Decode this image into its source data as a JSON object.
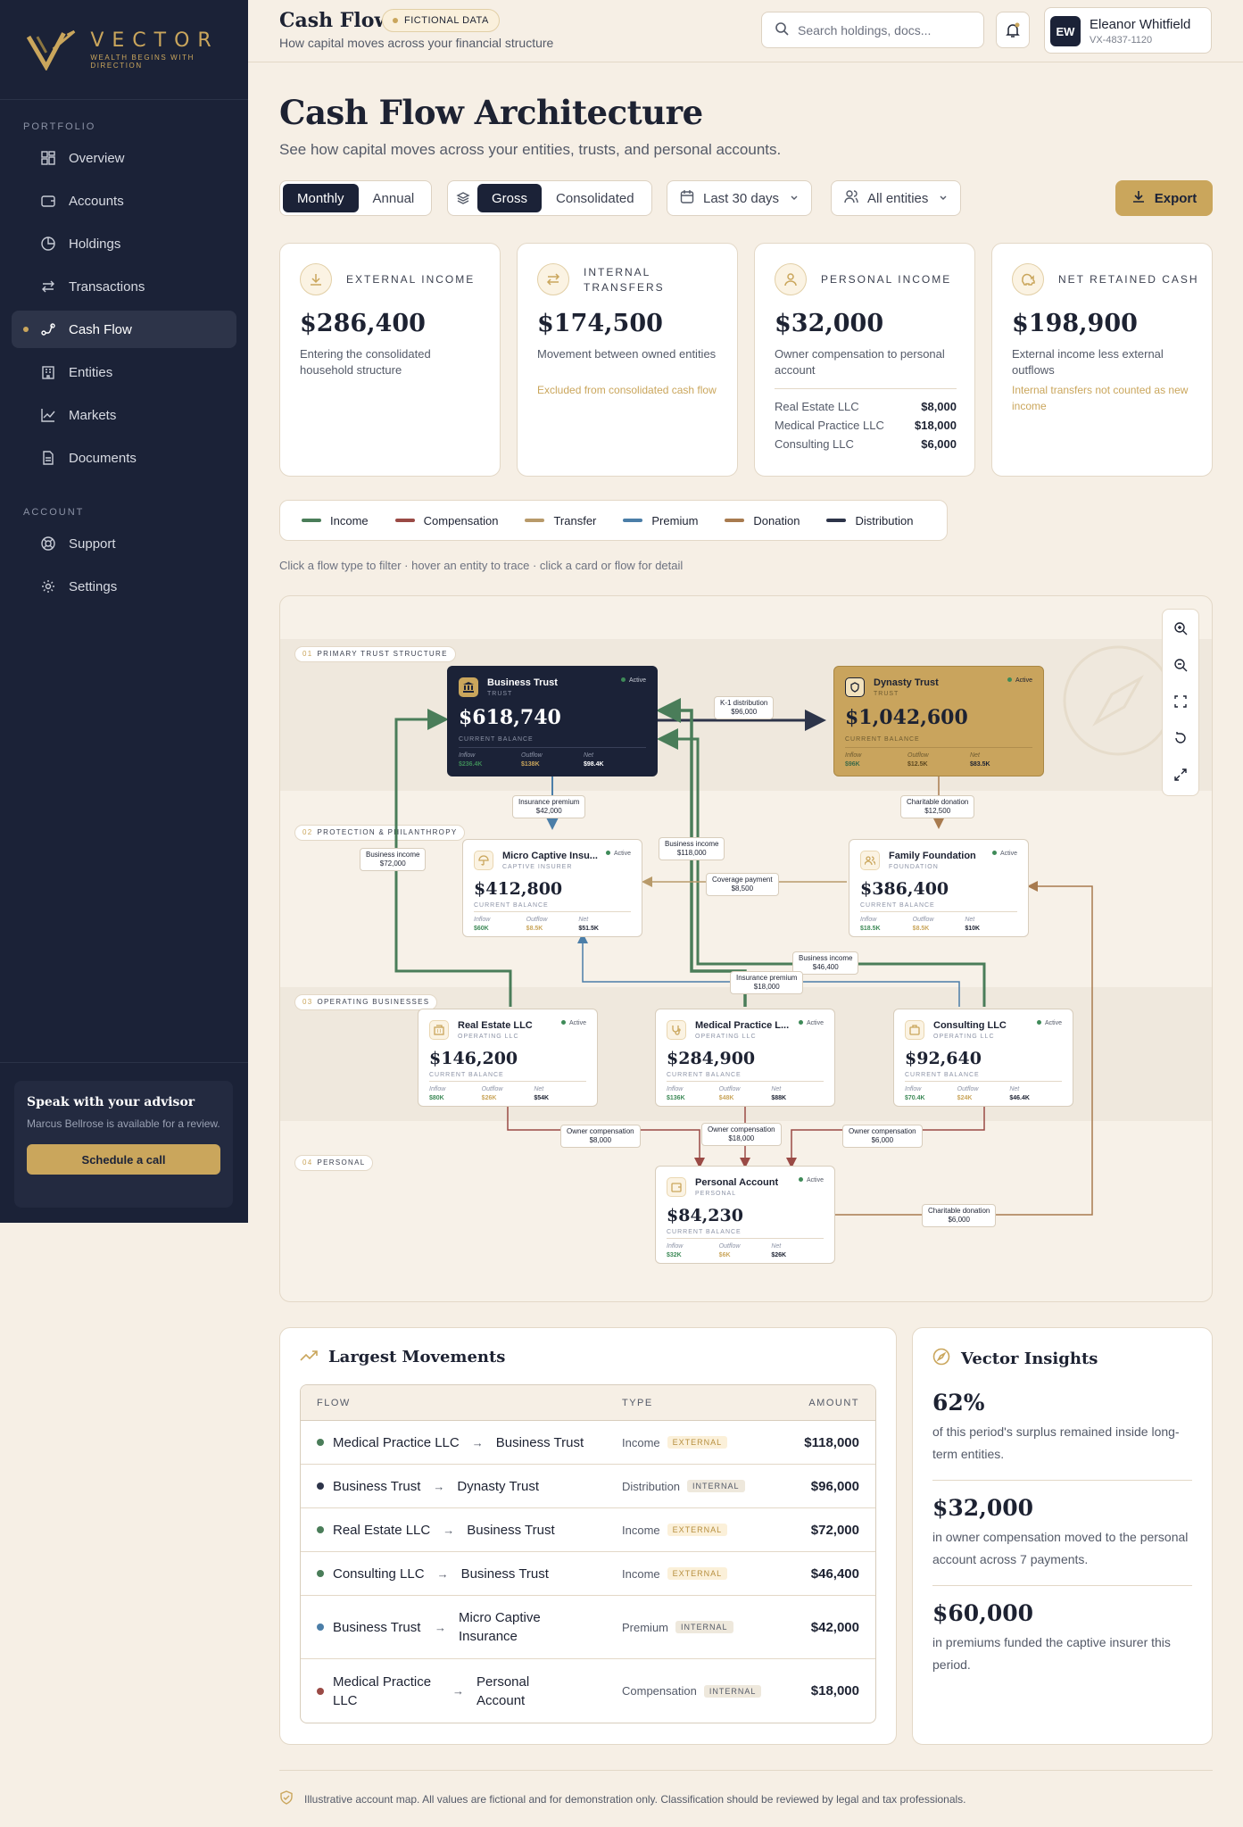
{
  "brand": {
    "name": "VECTOR",
    "tagline": "WEALTH BEGINS WITH DIRECTION",
    "accent": "#caa65c",
    "navy": "#1b2237"
  },
  "sidebar": {
    "portfolio_head": "PORTFOLIO",
    "items": [
      {
        "label": "Overview",
        "icon": "grid-icon"
      },
      {
        "label": "Accounts",
        "icon": "wallet-icon"
      },
      {
        "label": "Holdings",
        "icon": "pie-icon"
      },
      {
        "label": "Transactions",
        "icon": "swap-icon"
      },
      {
        "label": "Cash Flow",
        "icon": "flow-icon",
        "active": true
      },
      {
        "label": "Entities",
        "icon": "building-icon"
      },
      {
        "label": "Markets",
        "icon": "chart-icon"
      },
      {
        "label": "Documents",
        "icon": "document-icon"
      }
    ],
    "account_head": "ACCOUNT",
    "account_items": [
      {
        "label": "Support",
        "icon": "lifebuoy-icon"
      },
      {
        "label": "Settings",
        "icon": "gear-icon"
      }
    ],
    "advisor": {
      "title": "Speak with your advisor",
      "text": "Marcus Bellrose is available for a review.",
      "button": "Schedule a call"
    }
  },
  "topbar": {
    "title": "Cash Flow",
    "badge": "FICTIONAL DATA",
    "subtitle": "How capital moves across your financial structure",
    "search_placeholder": "Search holdings, docs...",
    "user": {
      "initials": "EW",
      "name": "Eleanor Whitfield",
      "id": "VX-4837-1120"
    }
  },
  "page": {
    "title": "Cash Flow Architecture",
    "subtitle": "See how capital moves across your entities, trusts, and personal accounts."
  },
  "controls": {
    "period": [
      "Monthly",
      "Annual"
    ],
    "period_selected": "Monthly",
    "view": [
      "Gross",
      "Consolidated"
    ],
    "view_selected": "Gross",
    "range": "Last 30 days",
    "entities": "All entities",
    "export": "Export"
  },
  "cards": [
    {
      "label": "EXTERNAL INCOME",
      "value": "$286,400",
      "desc": "Entering the consolidated household structure",
      "note": ""
    },
    {
      "label": "INTERNAL TRANSFERS",
      "value": "$174,500",
      "desc": "Movement between owned entities",
      "note": "Excluded from consolidated cash flow"
    },
    {
      "label": "PERSONAL INCOME",
      "value": "$32,000",
      "desc": "Owner compensation to personal account",
      "breakdown": [
        {
          "name": "Real Estate LLC",
          "amount": "$8,000"
        },
        {
          "name": "Medical Practice LLC",
          "amount": "$18,000"
        },
        {
          "name": "Consulting LLC",
          "amount": "$6,000"
        }
      ]
    },
    {
      "label": "NET RETAINED CASH",
      "value": "$198,900",
      "desc": "External income less external outflows",
      "note": "Internal transfers not counted as new income"
    }
  ],
  "legend": [
    {
      "label": "Income",
      "color": "#4a7d59"
    },
    {
      "label": "Compensation",
      "color": "#9a4a45"
    },
    {
      "label": "Transfer",
      "color": "#b89a6a"
    },
    {
      "label": "Premium",
      "color": "#4b7ea8"
    },
    {
      "label": "Donation",
      "color": "#a87b4f"
    },
    {
      "label": "Distribution",
      "color": "#2d3449"
    }
  ],
  "hint": "Click a flow type to filter · hover an entity to trace · click a card or flow for detail",
  "map": {
    "bands": [
      {
        "num": "01",
        "label": "PRIMARY TRUST STRUCTURE"
      },
      {
        "num": "02",
        "label": "PROTECTION & PHILANTHROPY"
      },
      {
        "num": "03",
        "label": "OPERATING BUSINESSES"
      },
      {
        "num": "04",
        "label": "PERSONAL"
      }
    ],
    "nodes": [
      {
        "name": "Business Trust",
        "type": "TRUST",
        "status": "Active",
        "value": "$618,740",
        "label": "CURRENT BALANCE",
        "inflow": "$236.4K",
        "outflow": "$138K",
        "net": "$98.4K"
      },
      {
        "name": "Dynasty Trust",
        "type": "TRUST",
        "status": "Active",
        "value": "$1,042,600",
        "label": "CURRENT BALANCE",
        "inflow": "$96K",
        "outflow": "$12.5K",
        "net": "$83.5K"
      },
      {
        "name": "Micro Captive Insu...",
        "type": "CAPTIVE INSURER",
        "status": "Active",
        "value": "$412,800",
        "label": "CURRENT BALANCE",
        "inflow": "$60K",
        "outflow": "$8.5K",
        "net": "$51.5K"
      },
      {
        "name": "Family Foundation",
        "type": "FOUNDATION",
        "status": "Active",
        "value": "$386,400",
        "label": "CURRENT BALANCE",
        "inflow": "$18.5K",
        "outflow": "$8.5K",
        "net": "$10K"
      },
      {
        "name": "Real Estate LLC",
        "type": "OPERATING LLC",
        "status": "Active",
        "value": "$146,200",
        "label": "CURRENT BALANCE",
        "inflow": "$80K",
        "outflow": "$26K",
        "net": "$54K"
      },
      {
        "name": "Medical Practice L...",
        "type": "OPERATING LLC",
        "status": "Active",
        "value": "$284,900",
        "label": "CURRENT BALANCE",
        "inflow": "$136K",
        "outflow": "$48K",
        "net": "$88K"
      },
      {
        "name": "Consulting LLC",
        "type": "OPERATING LLC",
        "status": "Active",
        "value": "$92,640",
        "label": "CURRENT BALANCE",
        "inflow": "$70.4K",
        "outflow": "$24K",
        "net": "$46.4K"
      },
      {
        "name": "Personal Account",
        "type": "PERSONAL",
        "status": "Active",
        "value": "$84,230",
        "label": "CURRENT BALANCE",
        "inflow": "$32K",
        "outflow": "$6K",
        "net": "$26K"
      }
    ],
    "inflow_label": "Inflow",
    "outflow_label": "Outflow",
    "net_label": "Net",
    "flows": [
      {
        "l1": "K-1 distribution",
        "l2": "$96,000"
      },
      {
        "l1": "Insurance premium",
        "l2": "$42,000"
      },
      {
        "l1": "Charitable donation",
        "l2": "$12,500"
      },
      {
        "l1": "Business income",
        "l2": "$72,000"
      },
      {
        "l1": "Business income",
        "l2": "$118,000"
      },
      {
        "l1": "Coverage payment",
        "l2": "$8,500"
      },
      {
        "l1": "Business income",
        "l2": "$46,400"
      },
      {
        "l1": "Insurance premium",
        "l2": "$18,000"
      },
      {
        "l1": "Owner compensation",
        "l2": "$8,000"
      },
      {
        "l1": "Owner compensation",
        "l2": "$18,000"
      },
      {
        "l1": "Owner compensation",
        "l2": "$6,000"
      },
      {
        "l1": "Charitable donation",
        "l2": "$6,000"
      }
    ]
  },
  "movements": {
    "title": "Largest Movements",
    "headers": {
      "flow": "FLOW",
      "type": "TYPE",
      "amount": "AMOUNT"
    },
    "rows": [
      {
        "from": "Medical Practice LLC",
        "to": "Business Trust",
        "type": "Income",
        "tag": "EXTERNAL",
        "amount": "$118,000",
        "color": "#4a7d59"
      },
      {
        "from": "Business Trust",
        "to": "Dynasty Trust",
        "type": "Distribution",
        "tag": "INTERNAL",
        "amount": "$96,000",
        "color": "#2d3449"
      },
      {
        "from": "Real Estate LLC",
        "to": "Business Trust",
        "type": "Income",
        "tag": "EXTERNAL",
        "amount": "$72,000",
        "color": "#4a7d59"
      },
      {
        "from": "Consulting LLC",
        "to": "Business Trust",
        "type": "Income",
        "tag": "EXTERNAL",
        "amount": "$46,400",
        "color": "#4a7d59"
      },
      {
        "from": "Business Trust",
        "to": "Micro Captive Insurance",
        "type": "Premium",
        "tag": "INTERNAL",
        "amount": "$42,000",
        "color": "#4b7ea8"
      },
      {
        "from": "Medical Practice LLC",
        "to": "Personal Account",
        "type": "Compensation",
        "tag": "INTERNAL",
        "amount": "$18,000",
        "color": "#9a4a45"
      }
    ]
  },
  "insights": {
    "title": "Vector Insights",
    "items": [
      {
        "value": "62%",
        "desc": "of this period's surplus remained inside long-term entities."
      },
      {
        "value": "$32,000",
        "desc": "in owner compensation moved to the personal account across 7 payments."
      },
      {
        "value": "$60,000",
        "desc": "in premiums funded the captive insurer this period."
      }
    ]
  },
  "footer": "Illustrative account map. All values are fictional and for demonstration only. Classification should be reviewed by legal and tax professionals."
}
